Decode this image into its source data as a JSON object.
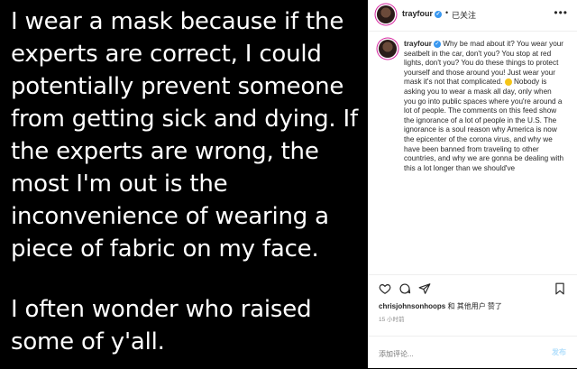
{
  "image": {
    "paragraph_1": "I wear a mask because if the experts are correct, I could potentially prevent someone from getting sick and dying. If the experts are wrong, the most I'm out is the inconvenience of wearing a piece of fabric on my face.",
    "paragraph_2": "I often wonder who raised some of y'all."
  },
  "header": {
    "username": "trayfour",
    "separator": "•",
    "follow_status": "已关注",
    "more": "•••"
  },
  "caption": {
    "username": "trayfour",
    "body_before_emoji": "Why be mad about it? You wear your seatbelt in the car, don't you? You stop at red lights, don't you? You do these things to protect yourself and those around you! Just wear your mask it's not that complicated.",
    "body_after_emoji": "Nobody is asking you to wear a mask all day, only when you go into public spaces where you're around a lot of people. The comments on this feed show the ignorance of a lot of people in the U.S. The ignorance is a soul reason why America is now the epicenter of the corona virus, and why we have been banned from traveling to other countries, and why we are gonna be dealing with this a lot longer than we should've"
  },
  "likes": {
    "user": "chrisjohnsonhoops",
    "text": "和 其他用户 赞了"
  },
  "time": "15 小时前",
  "comment": {
    "placeholder": "添加评论...",
    "post_label": "发布"
  }
}
